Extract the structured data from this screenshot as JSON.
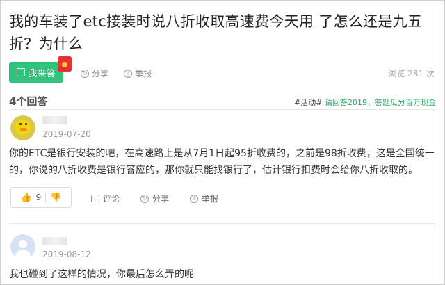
{
  "question": {
    "title": "我的车装了etc接装时说八折收取高速费今天用 了怎么还是九五折？为什么",
    "answer_button": "我来答",
    "share": "分享",
    "report": "举报",
    "views": "浏览 281 次"
  },
  "answers_header": {
    "count": "4个回答",
    "activity_tag": "#活动#",
    "activity_text": " 请回答2019，答题瓜分百万现金"
  },
  "answers": [
    {
      "date": "2019-07-20",
      "text": "你的ETC是银行安装的吧，在高速路上是从7月1日起95折收费的，之前是98折收费，这是全国统一的，你说的八折收费是银行答应的，那你就只能找银行了，估计银行扣费时会给你八折收取的。",
      "likes": "9",
      "comment": "评论",
      "share": "分享",
      "report": "举报"
    },
    {
      "date": "2019-08-12",
      "text": "我也碰到了这样的情况，你最后怎么弄的呢"
    }
  ]
}
